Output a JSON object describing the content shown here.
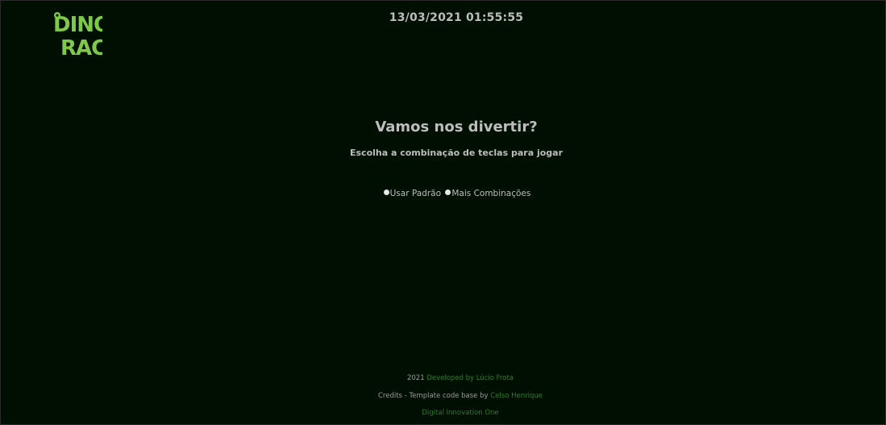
{
  "logo": {
    "line1": "DINO",
    "line2": "RACE",
    "color": "#7ec94a"
  },
  "datetime": "13/03/2021 01:55:55",
  "main": {
    "title": "Vamos nos divertir?",
    "subtitle": "Escolha a combinação de teclas para jogar",
    "options": [
      {
        "label": "Usar Padrão"
      },
      {
        "label": "Mais Combinações"
      }
    ]
  },
  "footer": {
    "year": "2021",
    "dev_link": "Developed by Lúcio Frota",
    "credits_text": "Credits - Template code base by",
    "credits_link": "Celso Henrique",
    "org_link": "Digital Innovation One"
  },
  "colors": {
    "background": "#001000",
    "text": "#bdbdbd",
    "link": "#2f7a2f"
  }
}
